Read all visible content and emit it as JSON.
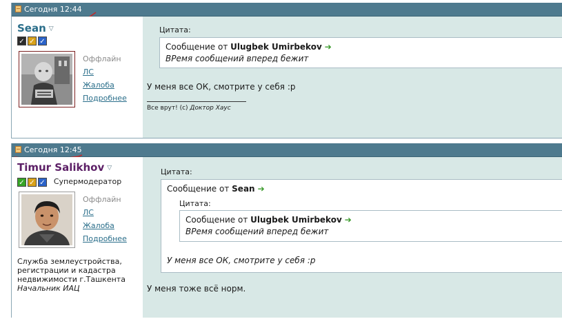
{
  "posts": [
    {
      "date": "Сегодня 12:44",
      "author": {
        "name": "Sean",
        "status": "Оффлайн",
        "links": [
          "ЛС",
          "Жалоба",
          "Подробнее"
        ],
        "badges": [
          "dark",
          "gold",
          "blue"
        ]
      },
      "quote_label": "Цитата:",
      "quote": {
        "prefix": "Сообщение от",
        "author": "Ulugbek Umirbekov",
        "text": "ВРемя сообщений вперед бежит"
      },
      "body": "У меня все ОК, смотрите у себя :p",
      "signature": {
        "text": "Все врут! (с)",
        "author": "Доктор Хаус"
      }
    },
    {
      "date": "Сегодня 12:45",
      "author": {
        "name": "Timur Salikhov",
        "title": "Супермодератор",
        "status": "Оффлайн",
        "links": [
          "ЛС",
          "Жалоба",
          "Подробнее"
        ],
        "badges": [
          "green",
          "gold",
          "blue"
        ],
        "signature": "Служба землеустройства, регистрации и кадастра недвижимости г.Ташкента",
        "role": "Начальник ИАЦ"
      },
      "quote_label": "Цитата:",
      "quote": {
        "prefix": "Сообщение от",
        "author": "Sean",
        "inner_label": "Цитата:",
        "inner": {
          "prefix": "Сообщение от",
          "author": "Ulugbek Umirbekov",
          "text": "ВРемя сообщений вперед бежит"
        },
        "text": "У меня все ОК, смотрите у себя :p"
      },
      "body": "У меня тоже всё норм."
    }
  ],
  "icons": {
    "date": "document-icon",
    "menu": "chevron-down-icon",
    "quote_link": "arrow-right-icon"
  },
  "colors": {
    "header_bar": "#4e7a8e",
    "message_bg": "#d8e8e6",
    "sean_name": "#2a6e8a",
    "timur_name": "#5c1f66",
    "link": "#2a6e8a",
    "annotation": "#c62828"
  }
}
